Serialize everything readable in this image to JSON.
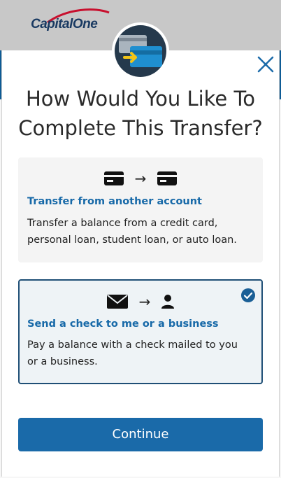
{
  "brand": {
    "logo_text": "Capital One",
    "logo_text_main": "Capital",
    "logo_text_italic": "One",
    "colors": {
      "brand_navy": "#1a3a62",
      "brand_red": "#c8102e",
      "accent": "#1a6aa9"
    }
  },
  "modal": {
    "badge_icon": "card-transfer-icon",
    "close_icon": "close-icon",
    "title_line_1": "How Would You Like To",
    "title_line_2": "Complete This Transfer?",
    "options": [
      {
        "icons": [
          "credit-card-icon",
          "arrow-right-icon",
          "credit-card-icon"
        ],
        "arrow": "→",
        "title": "Transfer from another account",
        "description": "Transfer a balance from a credit card, personal loan, student loan, or auto loan.",
        "selected": false
      },
      {
        "icons": [
          "envelope-icon",
          "arrow-right-icon",
          "person-icon"
        ],
        "arrow": "→",
        "title": "Send a check to me or a business",
        "description": "Pay a balance with a check mailed to you or a business.",
        "selected": true
      }
    ],
    "continue_label": "Continue"
  }
}
